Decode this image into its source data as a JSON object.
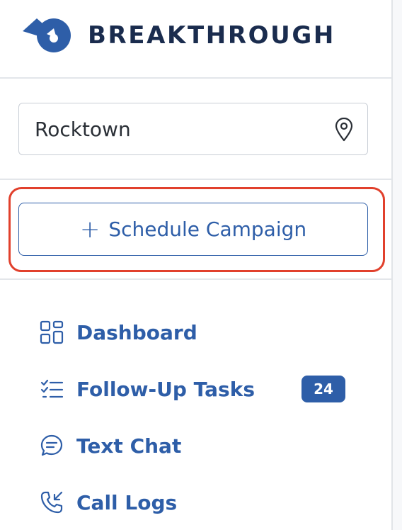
{
  "brand": {
    "name": "BREAKTHROUGH",
    "text_color": "#1a2c4e",
    "logo_color": "#2e5ea8"
  },
  "location": {
    "value": "Rocktown",
    "icon": "map-pin-icon"
  },
  "schedule": {
    "icon": "plus-icon",
    "plus": "+",
    "label": "Schedule Campaign",
    "highlight_color": "#e1402c"
  },
  "nav": {
    "accent": "#2e5ea8",
    "items": [
      {
        "label": "Dashboard",
        "icon": "dashboard-grid-icon"
      },
      {
        "label": "Follow-Up Tasks",
        "icon": "checklist-icon",
        "badge": "24"
      },
      {
        "label": "Text Chat",
        "icon": "chat-bubble-icon"
      },
      {
        "label": "Call Logs",
        "icon": "phone-incoming-icon"
      }
    ]
  }
}
